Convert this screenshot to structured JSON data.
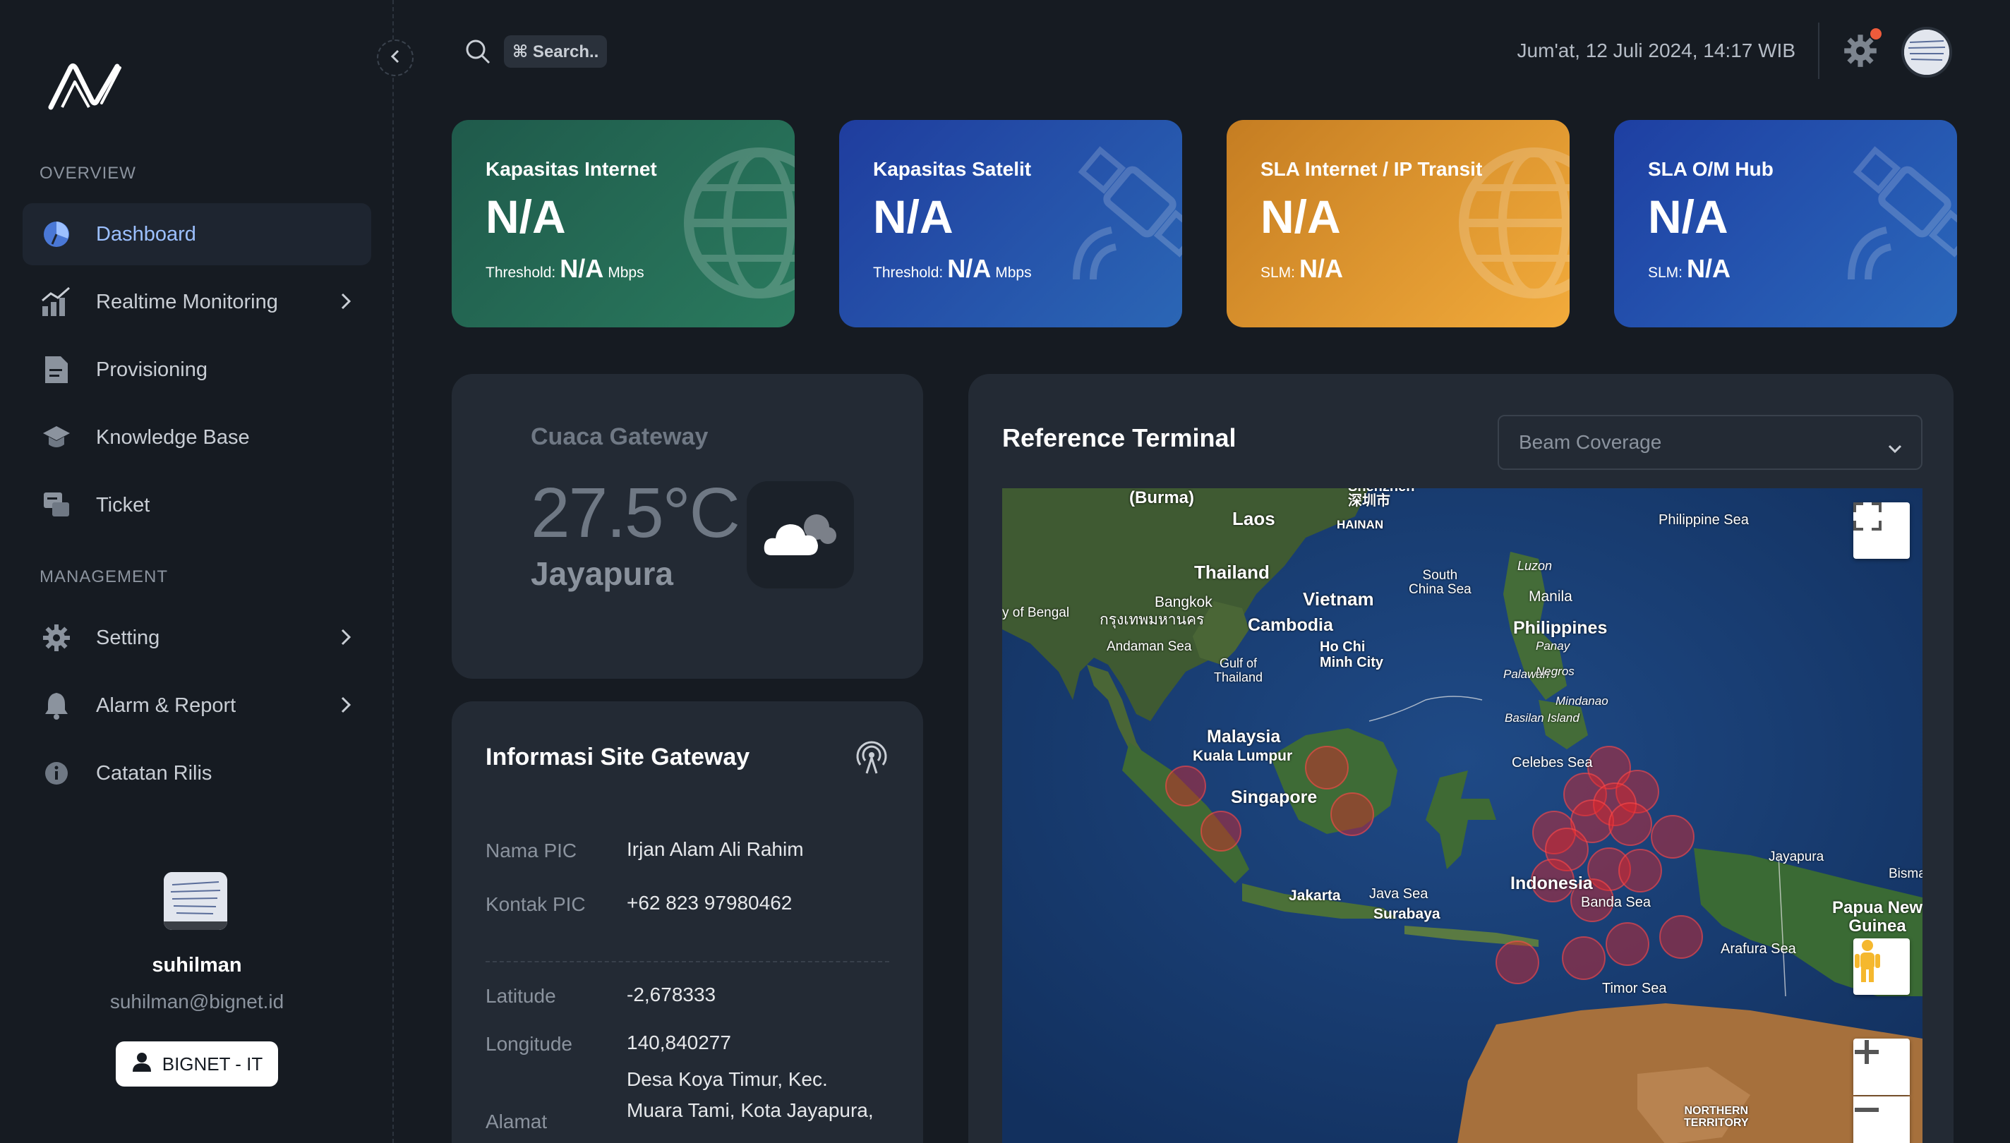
{
  "app": {
    "logo": "bignet-logo"
  },
  "sidebar": {
    "overview_label": "OVERVIEW",
    "management_label": "MANAGEMENT",
    "items": [
      {
        "label": "Dashboard",
        "icon": "dashboard-icon",
        "active": true
      },
      {
        "label": "Realtime Monitoring",
        "icon": "chart-icon",
        "has_children": true
      },
      {
        "label": "Provisioning",
        "icon": "document-icon"
      },
      {
        "label": "Knowledge Base",
        "icon": "graduation-cap-icon"
      },
      {
        "label": "Ticket",
        "icon": "ticket-icon"
      },
      {
        "label": "Setting",
        "icon": "gear-icon",
        "has_children": true
      },
      {
        "label": "Alarm & Report",
        "icon": "bell-icon",
        "has_children": true
      },
      {
        "label": "Catatan Rilis",
        "icon": "info-icon"
      }
    ],
    "profile": {
      "name": "suhilman",
      "email": "suhilman@bignet.id",
      "role_button": "BIGNET - IT"
    }
  },
  "topbar": {
    "search_placeholder": "⌘ Search..",
    "datetime": "Jum'at, 12 Juli 2024, 14:17 WIB",
    "notification_dot_color": "#ef5b3b"
  },
  "kpis": [
    {
      "title": "Kapasitas Internet",
      "value": "N/A",
      "sub_label": "Threshold:",
      "sub_value": "N/A",
      "sub_unit": "Mbps",
      "icon": "globe-icon",
      "color": "#1f5a4b"
    },
    {
      "title": "Kapasitas Satelit",
      "value": "N/A",
      "sub_label": "Threshold:",
      "sub_value": "N/A",
      "sub_unit": "Mbps",
      "icon": "satellite-icon",
      "color": "#1f3d9e"
    },
    {
      "title": "SLA Internet / IP Transit",
      "value": "N/A",
      "sub_label": "SLM:",
      "sub_value": "N/A",
      "sub_unit": "",
      "icon": "globe-icon",
      "color": "#e0952e"
    },
    {
      "title": "SLA O/M Hub",
      "value": "N/A",
      "sub_label": "SLM:",
      "sub_value": "N/A",
      "sub_unit": "",
      "icon": "satellite-icon",
      "color": "#1e3fa2"
    }
  ],
  "weather": {
    "title": "Cuaca Gateway",
    "temperature": "27.5°C",
    "city": "Jayapura",
    "icon": "cloud-icon"
  },
  "site": {
    "title": "Informasi Site Gateway",
    "rows": [
      {
        "label": "Nama PIC",
        "value": "Irjan Alam Ali Rahim"
      },
      {
        "label": "Kontak PIC",
        "value": "+62 823 97980462"
      },
      {
        "label": "Latitude",
        "value": "-2,678333"
      },
      {
        "label": "Longitude",
        "value": "140,840277"
      },
      {
        "label": "Alamat",
        "value_line1": "Desa Koya Timur, Kec.",
        "value_line2": "Muara Tami, Kota Jayapura,"
      }
    ]
  },
  "map_panel": {
    "title": "Reference Terminal",
    "select_value": "Beam Coverage",
    "labels": {
      "burma": "(Burma)",
      "laos": "Laos",
      "hainan": "HAINAN",
      "philippine_sea": "Philippine Sea",
      "thailand": "Thailand",
      "south_china_sea": "South\nChina Sea",
      "luzon": "Luzon",
      "manila": "Manila",
      "bangkok": "Bangkok",
      "bangkok_thai": "กรุงเทพมหานคร",
      "vietnam": "Vietnam",
      "bay_of_bengal": "y of Bengal",
      "cambodia": "Cambodia",
      "philippines": "Philippines",
      "panay": "Panay",
      "andaman_sea": "Andaman Sea",
      "ho_chi_minh": "Ho Chi\nMinh City",
      "palawan": "Palawan",
      "negros": "Negros",
      "gulf_thailand": "Gulf of\nThailand",
      "mindanao": "Mindanao",
      "basilan": "Basilan Island",
      "malaysia": "Malaysia",
      "kuala_lumpur": "Kuala Lumpur",
      "celebes_sea": "Celebes Sea",
      "singapore": "Singapore",
      "jayapura": "Jayapura",
      "bisma": "Bisma",
      "indonesia": "Indonesia",
      "jakarta": "Jakarta",
      "java_sea": "Java Sea",
      "surabaya": "Surabaya",
      "banda_sea": "Banda Sea",
      "papua_new_guinea": "Papua New\nGuinea",
      "arafura_sea": "Arafura Sea",
      "timor_sea": "Timor Sea",
      "northern_territory": "NORTHERN\nTERRITORY",
      "shenzhen": "Shenzhen\n深圳市"
    }
  }
}
